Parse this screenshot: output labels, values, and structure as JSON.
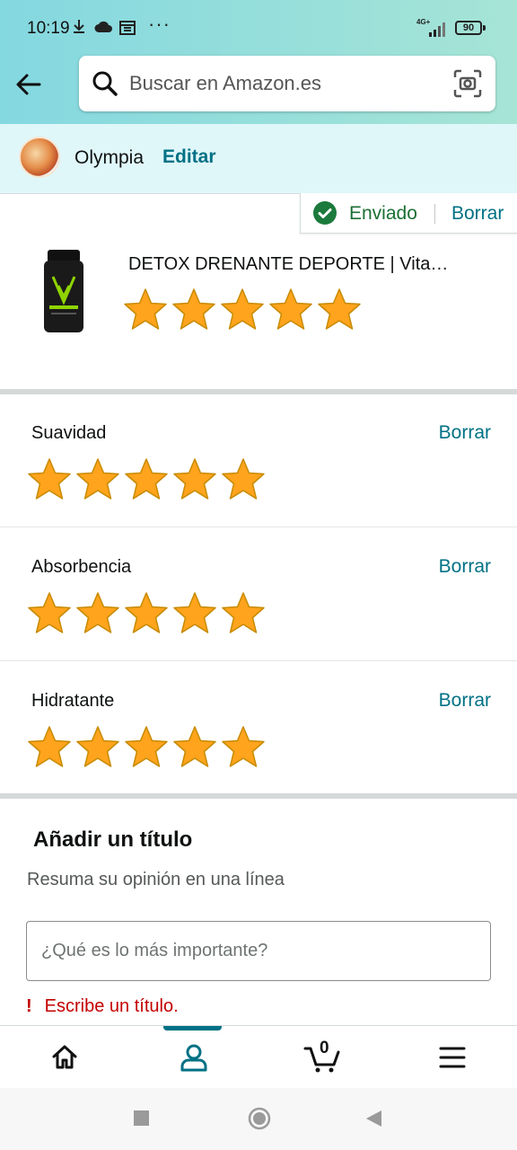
{
  "status_bar": {
    "time": "10:19",
    "network": "4G+",
    "battery": "90"
  },
  "search": {
    "placeholder": "Buscar en Amazon.es"
  },
  "profile": {
    "name": "Olympia",
    "edit_label": "Editar"
  },
  "review_status": {
    "sent_label": "Enviado",
    "delete_label": "Borrar"
  },
  "product": {
    "title": "DETOX DRENANTE DEPORTE | Vita…",
    "rating": 5,
    "max_rating": 5
  },
  "attributes": [
    {
      "label": "Suavidad",
      "rating": 5,
      "delete_label": "Borrar"
    },
    {
      "label": "Absorbencia",
      "rating": 5,
      "delete_label": "Borrar"
    },
    {
      "label": "Hidratante",
      "rating": 5,
      "delete_label": "Borrar"
    }
  ],
  "title_section": {
    "heading": "Añadir un título",
    "subtitle": "Resuma su opinión en una línea",
    "input_placeholder": "¿Qué es lo más importante?",
    "input_value": "",
    "error_icon": "!",
    "error_text": "Escribe un título."
  },
  "bottom_nav": {
    "items": [
      {
        "icon": "home-icon"
      },
      {
        "icon": "profile-icon",
        "active": true
      },
      {
        "icon": "cart-icon",
        "count": "0"
      },
      {
        "icon": "menu-icon"
      }
    ]
  },
  "colors": {
    "link": "#007185",
    "star": "#ffa41c",
    "success": "#1b6f33",
    "error": "#c40000",
    "header_gradient_start": "#84d8e0",
    "header_gradient_end": "#a6e4d6"
  }
}
